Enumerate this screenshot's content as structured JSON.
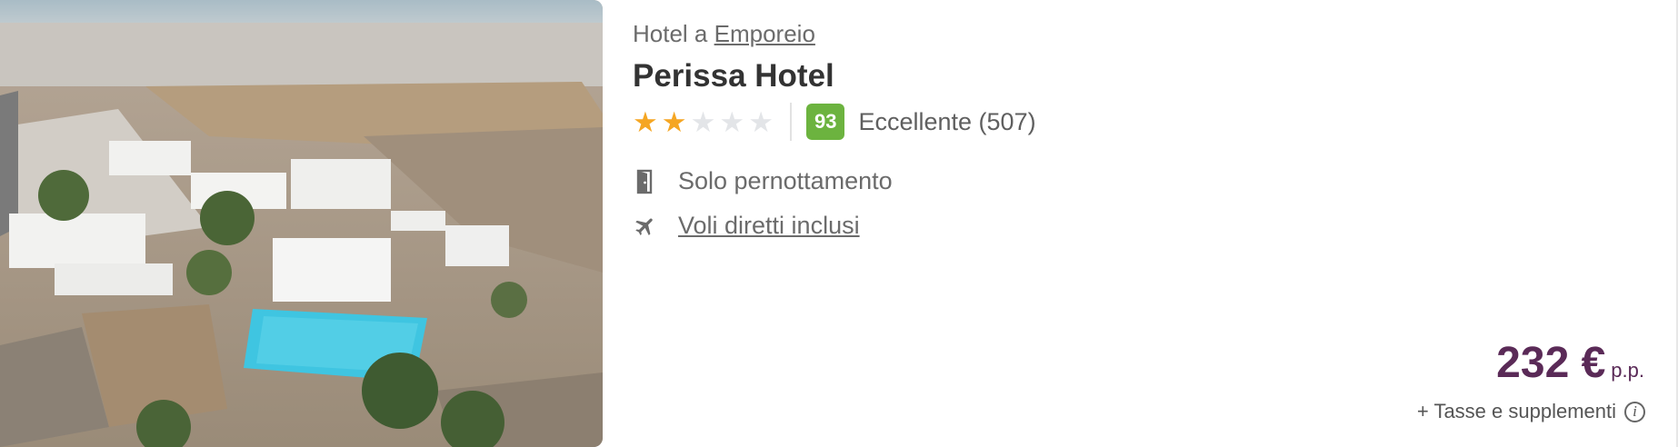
{
  "hotel": {
    "location_prefix": "Hotel a",
    "location_link": "Emporeio",
    "name": "Perissa Hotel",
    "star_rating": 2,
    "star_max": 5,
    "score": "93",
    "score_text": "Eccellente (507)"
  },
  "features": [
    {
      "icon": "door-icon",
      "label": "Solo pernottamento"
    },
    {
      "icon": "plane-icon",
      "label": "Voli diretti inclusi"
    }
  ],
  "price": {
    "amount": "232 €",
    "unit": "p.p.",
    "taxes": "+ Tasse e supplementi",
    "info_symbol": "i"
  },
  "colors": {
    "star_active": "#f5a623",
    "star_inactive": "#e3e5e8",
    "score_badge": "#6cb33f",
    "price": "#5a2a57"
  }
}
